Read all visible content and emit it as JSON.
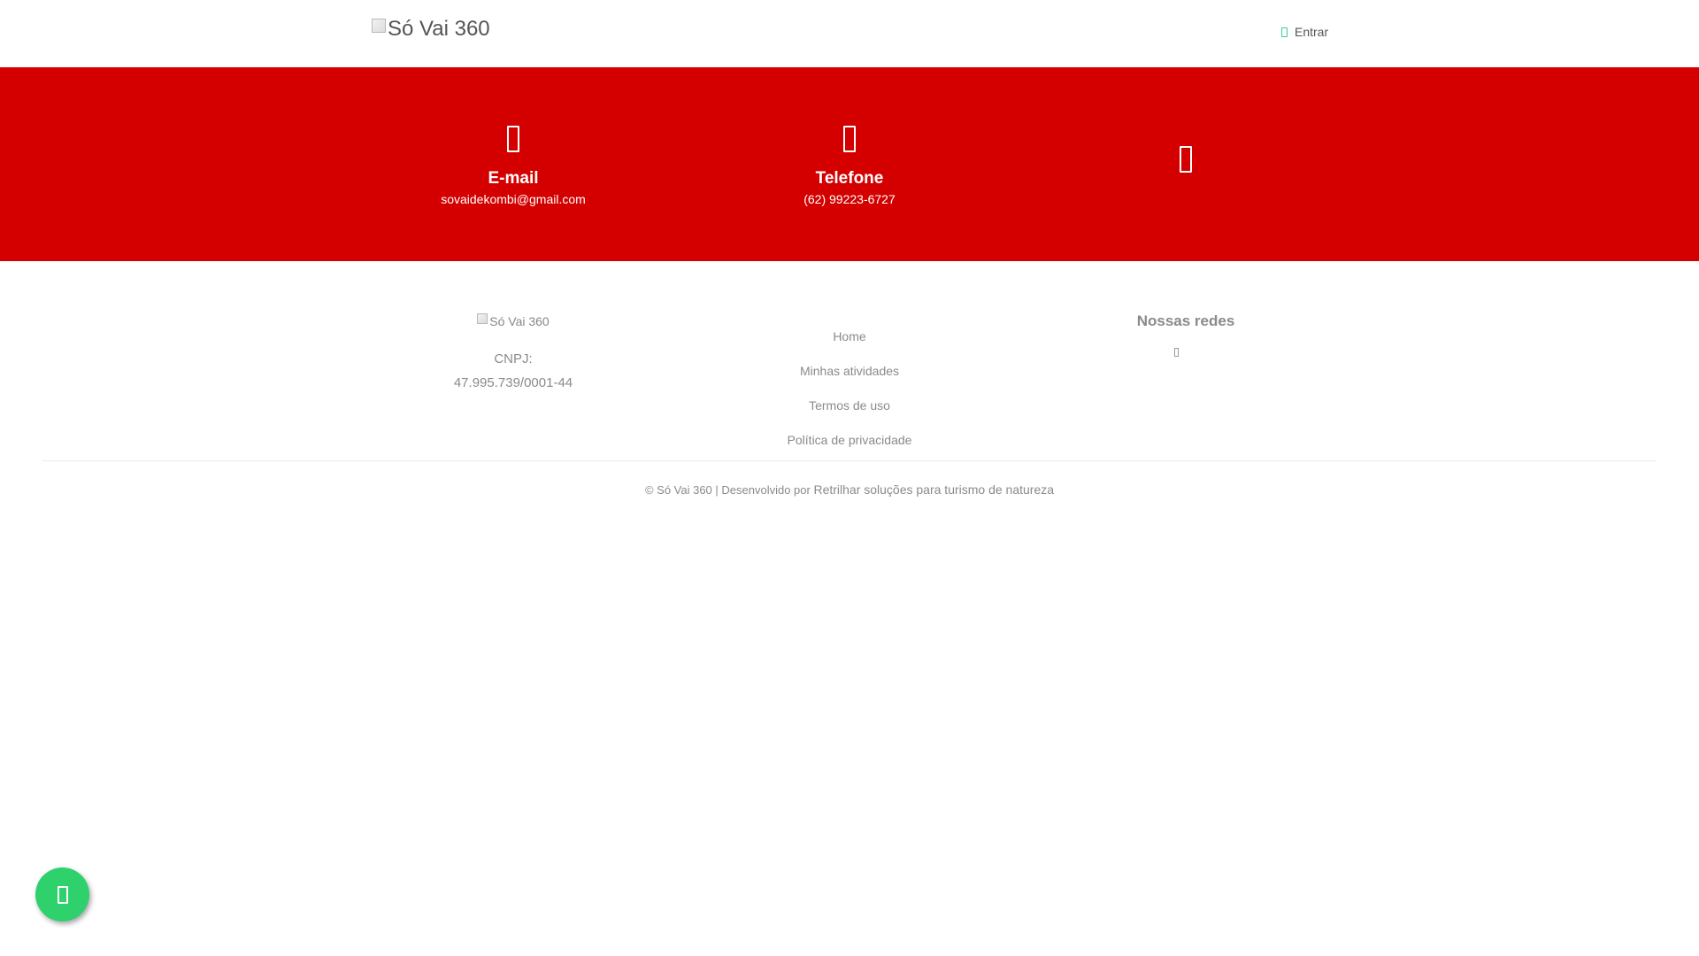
{
  "header": {
    "logo_alt": "Só Vai 360",
    "login_label": "Entrar",
    "login_icon": "sign-in-icon"
  },
  "contact": {
    "email": {
      "icon": "envelope-icon",
      "title": "E-mail",
      "value": "sovaidekombi@gmail.com"
    },
    "phone": {
      "icon": "phone-icon",
      "title": "Telefone",
      "value": "(62) 99223-6727"
    },
    "social": {
      "icon": "social-icon"
    },
    "band_color": "#d40000"
  },
  "footer": {
    "logo_alt": "Só Vai 360",
    "cnpj_label": "CNPJ:",
    "cnpj_value": "47.995.739/0001-44",
    "links": [
      {
        "label": "Home"
      },
      {
        "label": "Minhas atividades"
      },
      {
        "label": "Termos de uso"
      },
      {
        "label": "Política de privacidade"
      }
    ],
    "social_title": "Nossas redes",
    "social_icon": "instagram-icon"
  },
  "copyright": {
    "prefix": "© Só Vai 360 | Desenvolvido por",
    "developer": "Retrilhar soluções para turismo de natureza"
  },
  "whatsapp": {
    "icon": "whatsapp-icon",
    "color": "#2ed16b"
  }
}
